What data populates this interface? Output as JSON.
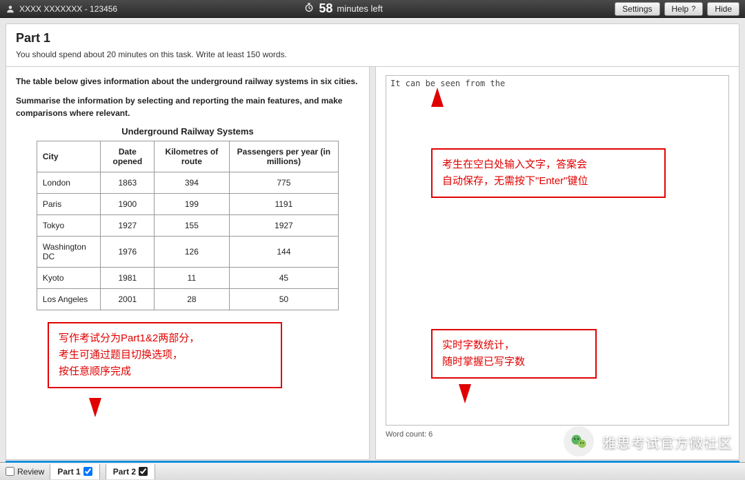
{
  "topbar": {
    "user_label": "XXXX XXXXXXX - 123456",
    "minutes": "58",
    "minutes_suffix": "minutes left",
    "settings": "Settings",
    "help": "Help",
    "hide": "Hide"
  },
  "header": {
    "title": "Part 1",
    "instruction": "You should spend about 20 minutes on this task. Write at least 150 words."
  },
  "prompt": {
    "line1": "The table below gives information about the underground railway systems in six cities.",
    "line2": "Summarise the information by selecting and reporting the main features, and make comparisons where relevant."
  },
  "chart_data": {
    "type": "table",
    "title": "Underground Railway Systems",
    "columns": [
      "City",
      "Date opened",
      "Kilometres of route",
      "Passengers per year (in millions)"
    ],
    "rows": [
      [
        "London",
        1863,
        394,
        775
      ],
      [
        "Paris",
        1900,
        199,
        1191
      ],
      [
        "Tokyo",
        1927,
        155,
        1927
      ],
      [
        "Washington DC",
        1976,
        126,
        144
      ],
      [
        "Kyoto",
        1981,
        11,
        45
      ],
      [
        "Los Angeles",
        2001,
        28,
        50
      ]
    ]
  },
  "editor": {
    "value": "It can be seen from the",
    "word_count_label": "Word count: 6"
  },
  "annotations": {
    "left": "写作考试分为Part1&2两部分，\n考生可通过题目切换选项，\n按任意顺序完成",
    "right_top": "考生在空白处输入文字，答案会\n自动保存，无需按下\"Enter\"键位",
    "right_bottom": "实时字数统计，\n随时掌握已写字数"
  },
  "bottombar": {
    "review": "Review",
    "part1": "Part 1",
    "part2": "Part 2"
  },
  "watermark": "雅思考试官方微社区"
}
